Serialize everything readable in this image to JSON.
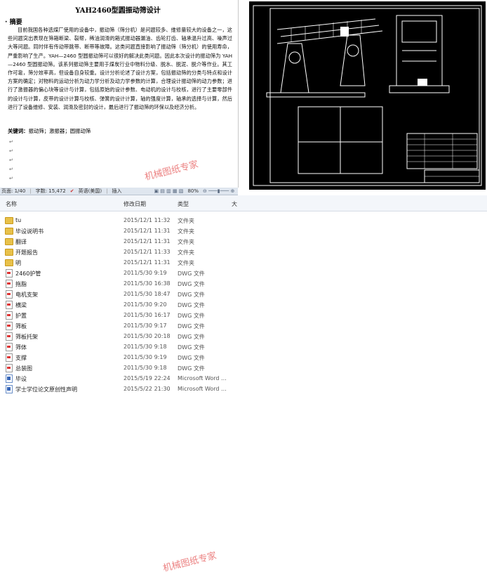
{
  "document": {
    "title": "YAH2460型圆振动筛设计",
    "abstract_heading": "摘要",
    "abstract_body": "目前我国各种选煤厂使用的设备中，振动筛（筛分机）是问题较多、维修量较大的设备之一，这些问题突出表现在筛箱断梁、裂帮，稀油润滑的箱式振动器漏油、齿轮打齿、轴承温升过高、噪声过大等问题。同时伴有传动带跳带、断带等故障。这类问题直接影响了振动筛（筛分机）的使用寿命，严重影响了生产。YAH—2460 型圆振动筛可以很好的解决此类问题。因此本次设计的振动筛为 YAH—2460 型圆振动筛。该系列振动筛主要用于煤炭行业中物料分级、脱水、脱泥、脱介等作业。其工作可靠，筛分效率高，但设备自身较重。设计分析论述了设计方案，包括振动筛的分类与特点和设计方案的确定；对物料的运动分析为动力学分析及动力学参数的计算，合理设计振动筛的动力参数；进行了激振器的偏心块等设计与计算，包括原始的设计参数、电动机的设计与校核，进行了主要零部件的设计与计算，皮带的设计计算与校核、弹簧的设计计算，轴的强度计算，轴承的选择与计算，然后进行了设备维修、安装、润滑及密封的设计，最后进行了振动筛的环保以及经济分析。",
    "keywords_label": "关键词：",
    "keywords": "振动筛；激振器；圆振动筛",
    "watermark": "机械图纸专家"
  },
  "status_bar": {
    "page": "页面: 1/40",
    "words": "字数: 15,472",
    "language": "英语(美国)",
    "mode": "插入",
    "zoom": "80%"
  },
  "explorer": {
    "columns": [
      "名称",
      "修改日期",
      "类型",
      "大"
    ],
    "rows": [
      {
        "name": "tu",
        "date": "2015/12/1 11:32",
        "type": "文件夹",
        "icon": "folder-icon"
      },
      {
        "name": "毕设说明书",
        "date": "2015/12/1 11:31",
        "type": "文件夹",
        "icon": "folder-icon"
      },
      {
        "name": "翻译",
        "date": "2015/12/1 11:31",
        "type": "文件夹",
        "icon": "folder-icon"
      },
      {
        "name": "开题报告",
        "date": "2015/12/1 11:33",
        "type": "文件夹",
        "icon": "folder-icon"
      },
      {
        "name": "明",
        "date": "2015/12/1 11:31",
        "type": "文件夹",
        "icon": "folder-icon"
      },
      {
        "name": "2460护管",
        "date": "2011/5/30 9:19",
        "type": "DWG 文件",
        "icon": "dwg-icon"
      },
      {
        "name": "拖脂",
        "date": "2011/5/30 16:38",
        "type": "DWG 文件",
        "icon": "dwg-icon"
      },
      {
        "name": "电机支架",
        "date": "2011/5/30 18:47",
        "type": "DWG 文件",
        "icon": "dwg-icon"
      },
      {
        "name": "横梁",
        "date": "2011/5/30 9:20",
        "type": "DWG 文件",
        "icon": "dwg-icon"
      },
      {
        "name": "护置",
        "date": "2011/5/30 16:17",
        "type": "DWG 文件",
        "icon": "dwg-icon"
      },
      {
        "name": "筛板",
        "date": "2011/5/30 9:17",
        "type": "DWG 文件",
        "icon": "dwg-icon"
      },
      {
        "name": "筛板托架",
        "date": "2011/5/30 20:18",
        "type": "DWG 文件",
        "icon": "dwg-icon"
      },
      {
        "name": "筛体",
        "date": "2011/5/30 9:18",
        "type": "DWG 文件",
        "icon": "dwg-icon"
      },
      {
        "name": "支撑",
        "date": "2011/5/30 9:19",
        "type": "DWG 文件",
        "icon": "dwg-icon"
      },
      {
        "name": "总装图",
        "date": "2011/5/30 9:18",
        "type": "DWG 文件",
        "icon": "dwg-icon"
      },
      {
        "name": "毕设",
        "date": "2015/5/19 22:24",
        "type": "Microsoft Word ...",
        "icon": "word-doc-icon"
      },
      {
        "name": "学士学位论文原创性声明",
        "date": "2015/5/22 21:30",
        "type": "Microsoft Word ...",
        "icon": "word-doc-icon"
      }
    ],
    "watermark": "机械图纸专家"
  },
  "colors": {
    "watermark": "#e86a6a",
    "cad_bg": "#000000",
    "cad_line": "#ffffff",
    "folder": "#e8c14a"
  }
}
